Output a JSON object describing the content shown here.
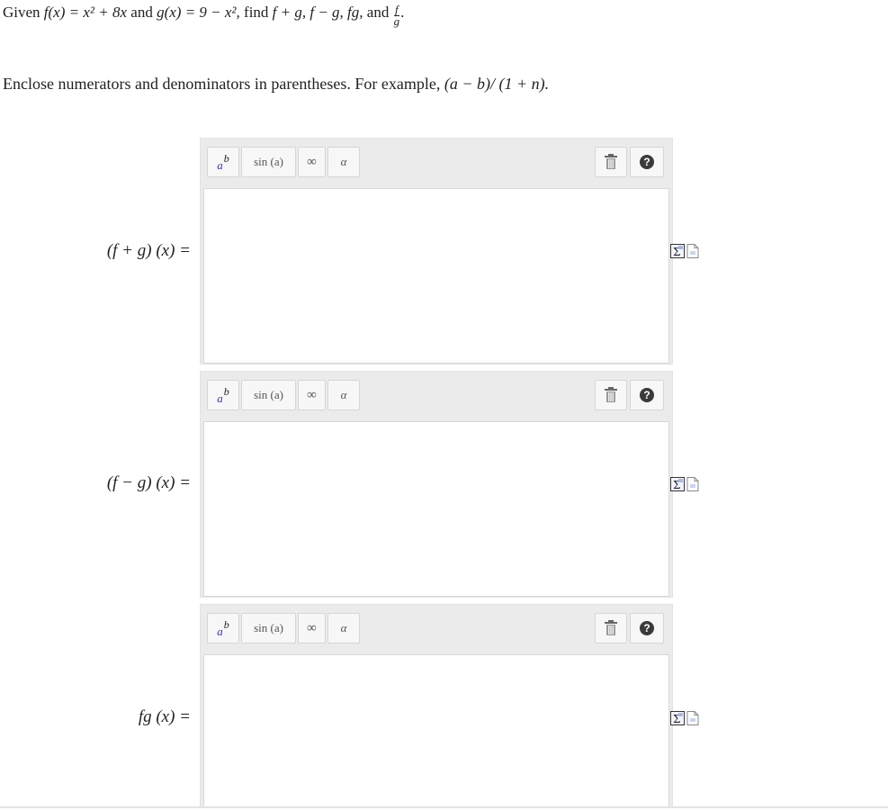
{
  "question": {
    "given": "Given",
    "f_def": "f(x) = x² + 8x",
    "and1": "and",
    "g_def": "g(x) = 9 − x²,",
    "find": "find",
    "ops": "f + g, f − g, fg,",
    "and2": "and",
    "frac_num": "f",
    "frac_den": "g",
    "period": "."
  },
  "instruction": {
    "text": "Enclose numerators and denominators in parentheses. For example,",
    "example": "(a − b)/ (1 + n)."
  },
  "rows": [
    {
      "label": "(f + g) (x) ="
    },
    {
      "label": "(f − g) (x) ="
    },
    {
      "label": "fg (x) ="
    }
  ],
  "toolbar": {
    "power_base": "a",
    "power_exp": "b",
    "sin_label": "sin (a)",
    "infinity_label": "∞",
    "alpha_label": "α",
    "help_label": "?"
  },
  "icons": {
    "power": "superscript-icon",
    "trash": "trash-icon",
    "help": "help-icon",
    "equation": "equation-editor-icon",
    "document": "document-icon"
  },
  "colors": {
    "toolbar_bg": "#ebebeb",
    "power_base": "#3a3aa8",
    "help_bg": "#3a3a3a"
  }
}
